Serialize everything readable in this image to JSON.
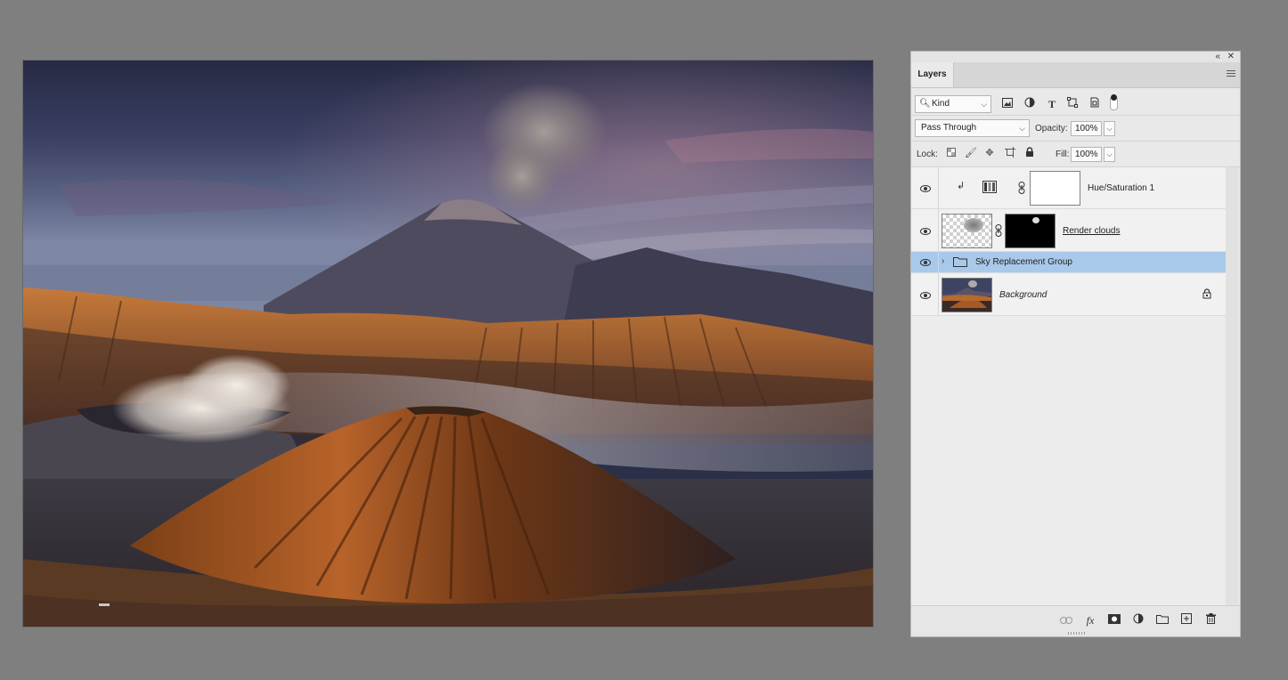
{
  "panel": {
    "tab_label": "Layers",
    "collapse_glyph": "«",
    "close_glyph": "✕"
  },
  "filter": {
    "kind_label": "Kind",
    "icons": [
      "image-filter-icon",
      "adjustment-filter-icon",
      "type-filter-icon",
      "shape-filter-icon",
      "smart-object-filter-icon"
    ]
  },
  "blend": {
    "mode": "Pass Through",
    "opacity_label": "Opacity:",
    "opacity_value": "100%",
    "lock_label": "Lock:",
    "fill_label": "Fill:",
    "fill_value": "100%"
  },
  "layers": [
    {
      "name": "Hue/Saturation 1",
      "type": "adjustment",
      "visible": true,
      "clipped": true
    },
    {
      "name": "Render clouds",
      "type": "pixel-with-mask",
      "visible": true
    },
    {
      "name": "Sky Replacement Group",
      "type": "group",
      "visible": true,
      "selected": true
    },
    {
      "name": "Background",
      "type": "background",
      "visible": true,
      "locked": true
    }
  ],
  "colors": {
    "canvas_bg": "#7f7f7f",
    "panel_bg": "#e9e9e9",
    "selected_row": "#a9c9ea"
  }
}
